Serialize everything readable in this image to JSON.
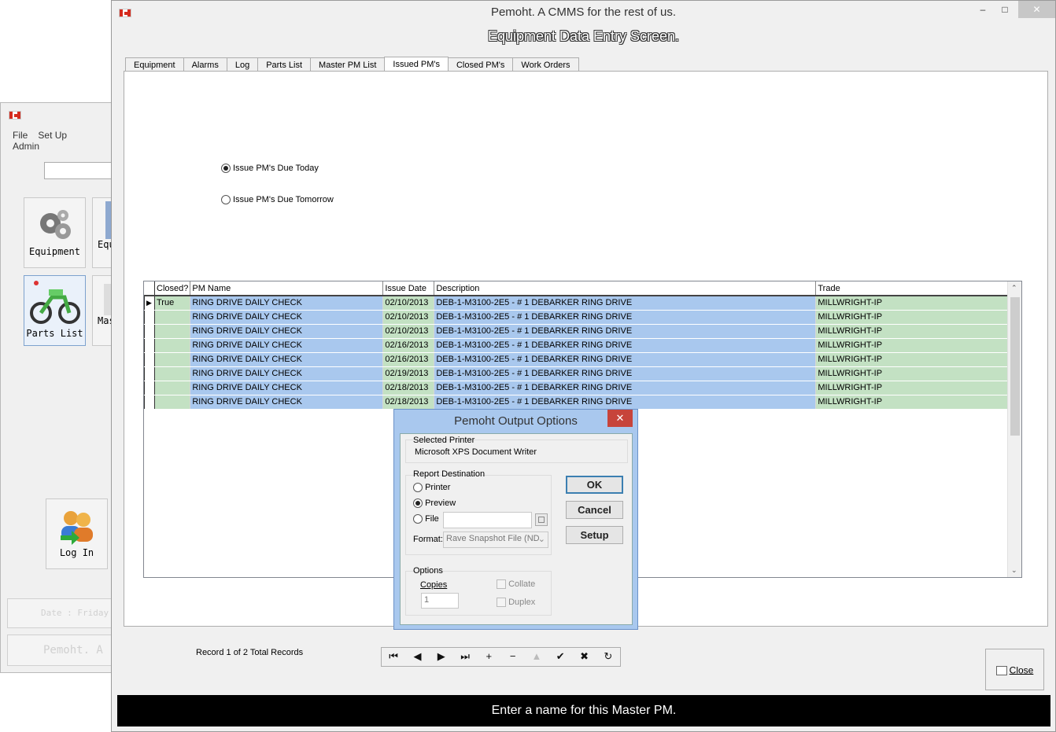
{
  "background_window": {
    "menu": [
      "File",
      "Set Up",
      "Admin"
    ],
    "tiles": {
      "equipment": "Equipment",
      "equipment_partial": "Equ",
      "parts_list": "Parts List",
      "master_partial": "Mas",
      "log_in": "Log In"
    },
    "date_strip": "Date : Friday",
    "title_strip": "Pemoht.  A"
  },
  "window": {
    "title": "Pemoht.  A CMMS for the rest of us.",
    "minimize": "–",
    "maximize": "□",
    "close": "✕"
  },
  "screen_title": "Equipment Data Entry Screen.",
  "tabs": [
    "Equipment",
    "Alarms",
    "Log",
    "Parts List",
    "Master PM List",
    "Issued PM's",
    "Closed PM's",
    "Work Orders"
  ],
  "active_tab": "Issued PM's",
  "options": {
    "due_today": "Issue PM's  Due Today",
    "due_tomorrow": "Issue PM's Due Tomorrow"
  },
  "grid": {
    "columns": [
      "Closed?",
      "PM Name",
      "Issue Date",
      "Description",
      "Trade"
    ],
    "rows": [
      [
        "True",
        "RING DRIVE DAILY CHECK",
        "02/10/2013",
        "DEB-1-M3100-2E5 - # 1 DEBARKER RING DRIVE",
        "MILLWRIGHT-IP"
      ],
      [
        "",
        "RING DRIVE DAILY CHECK",
        "02/10/2013",
        "DEB-1-M3100-2E5 - # 1 DEBARKER RING DRIVE",
        "MILLWRIGHT-IP"
      ],
      [
        "",
        "RING DRIVE DAILY CHECK",
        "02/10/2013",
        "DEB-1-M3100-2E5 - # 1 DEBARKER RING DRIVE",
        "MILLWRIGHT-IP"
      ],
      [
        "",
        "RING DRIVE DAILY CHECK",
        "02/16/2013",
        "DEB-1-M3100-2E5 - # 1 DEBARKER RING DRIVE",
        "MILLWRIGHT-IP"
      ],
      [
        "",
        "RING DRIVE DAILY CHECK",
        "02/16/2013",
        "DEB-1-M3100-2E5 - # 1 DEBARKER RING DRIVE",
        "MILLWRIGHT-IP"
      ],
      [
        "",
        "RING DRIVE DAILY CHECK",
        "02/19/2013",
        "DEB-1-M3100-2E5 - # 1 DEBARKER RING DRIVE",
        "MILLWRIGHT-IP"
      ],
      [
        "",
        "RING DRIVE DAILY CHECK",
        "02/18/2013",
        "DEB-1-M3100-2E5 - # 1 DEBARKER RING DRIVE",
        "MILLWRIGHT-IP"
      ],
      [
        "",
        "RING DRIVE DAILY CHECK",
        "02/18/2013",
        "DEB-1-M3100-2E5 - # 1 DEBARKER RING DRIVE",
        "MILLWRIGHT-IP"
      ]
    ]
  },
  "record_info": "Record 1 of 2 Total Records",
  "nav_buttons": [
    {
      "name": "first-record-button",
      "glyph": "⏮"
    },
    {
      "name": "prior-record-button",
      "glyph": "◀"
    },
    {
      "name": "next-record-button",
      "glyph": "▶"
    },
    {
      "name": "last-record-button",
      "glyph": "⏭"
    },
    {
      "name": "insert-record-button",
      "glyph": "+"
    },
    {
      "name": "delete-record-button",
      "glyph": "−"
    },
    {
      "name": "edit-record-button",
      "glyph": "▲"
    },
    {
      "name": "post-record-button",
      "glyph": "✔"
    },
    {
      "name": "cancel-edit-button",
      "glyph": "✖"
    },
    {
      "name": "refresh-button",
      "glyph": "↻"
    }
  ],
  "close_label": "Close",
  "status_message": "Enter a name for this Master PM.",
  "dialog": {
    "title": "Pemoht Output Options",
    "close": "✕",
    "selected_printer_label": "Selected Printer",
    "selected_printer": "Microsoft XPS Document Writer",
    "report_destination_label": "Report Destination",
    "dest_printer": "Printer",
    "dest_preview": "Preview",
    "dest_file": "File",
    "format_label": "Format:",
    "format_value": "Rave Snapshot File (ND",
    "options_label": "Options",
    "copies_label": "Copies",
    "copies_value": "1",
    "collate": "Collate",
    "duplex": "Duplex",
    "ok": "OK",
    "cancel": "Cancel",
    "setup": "Setup"
  },
  "colors": {
    "row_green": "#c3e1c3",
    "row_blue": "#a9c8ee",
    "status_bar": "#000000"
  }
}
